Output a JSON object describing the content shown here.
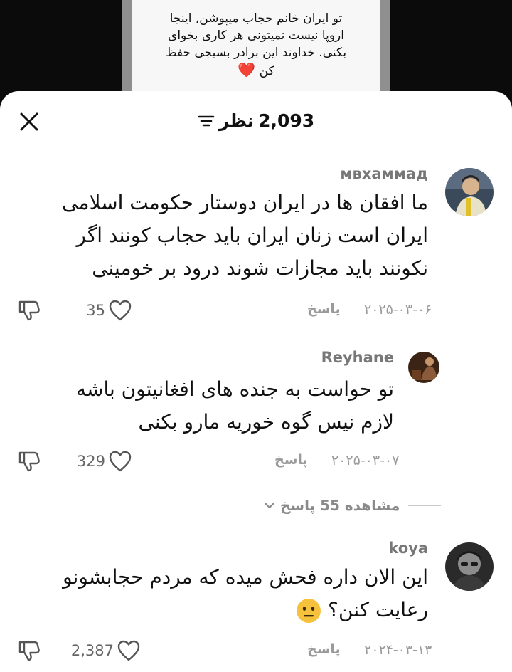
{
  "caption": {
    "lines": [
      "تو ایران خانم حجاب میپوشن, اینجا",
      "اروپا نیست نمیتونی هر کاری بخوای",
      "بکنی. خداوند این برادر بسیجی حفظ",
      "کن"
    ],
    "emoji": "❤️"
  },
  "sheet": {
    "views_count": "2,093",
    "views_label": "نظر"
  },
  "comments": [
    {
      "username": "мвхаммад",
      "lines": [
        "ما افقان ها در ایران دوستار حکومت اسلامی",
        "ایران است زنان ایران باید حجاب کونند اگر",
        "نکونند باید مجازات شوند درود بر خومینی"
      ],
      "date": "۲۰۲۵-۰۳-۰۶",
      "reply_label": "پاسخ",
      "likes": "35"
    },
    {
      "username": "Reyhane",
      "lines": [
        "تو حواست به جنده های افغانیتون باشه",
        "لازم نیس گوه خوریه مارو بکنی"
      ],
      "date": "۲۰۲۵-۰۳-۰۷",
      "reply_label": "پاسخ",
      "likes": "329",
      "view_replies": "مشاهده 55 پاسخ"
    },
    {
      "username": "koya",
      "lines": [
        "این الان داره فحش میده که مردم حجابشونو",
        "رعایت کنن؟"
      ],
      "date": "۲۰۲۴-۰۳-۱۳",
      "reply_label": "پاسخ",
      "likes": "2,387"
    }
  ],
  "colors": {
    "sheet_bg": "#ffffff",
    "text": "#111111",
    "muted": "#9a9a9a",
    "username": "#777777"
  },
  "icons": {
    "close": "close-icon",
    "filter": "filter-icon",
    "heart": "heart-outline-icon",
    "dislike": "thumbs-down-icon",
    "chevron": "chevron-down-icon",
    "emoji": "neutral-face-emoji"
  }
}
